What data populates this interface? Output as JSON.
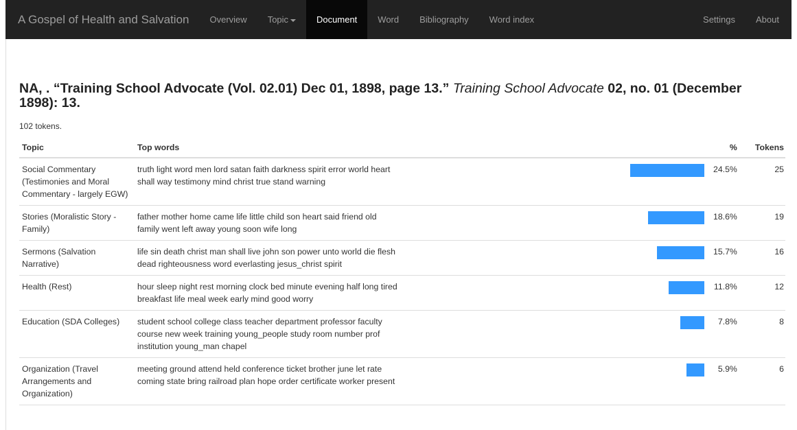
{
  "nav": {
    "brand": "A Gospel of Health and Salvation",
    "items": [
      "Overview",
      "Topic",
      "Document",
      "Word",
      "Bibliography",
      "Word index"
    ],
    "active": "Document",
    "right_items": [
      "Settings",
      "About"
    ]
  },
  "document": {
    "citation_prefix": "NA, . “Training School Advocate (Vol. 02.01) Dec 01, 1898, page 13.”",
    "citation_journal": "Training School Advocate",
    "citation_suffix": "02, no. 01 (December 1898): 13.",
    "tokens_text": "102 tokens."
  },
  "table": {
    "headers": {
      "topic": "Topic",
      "words": "Top words",
      "pct": "%",
      "tokens": "Tokens"
    },
    "rows": [
      {
        "topic": "Social Commentary (Testimonies and Moral Commentary - largely EGW)",
        "words": "truth light word men lord satan faith darkness spirit error world heart shall way testimony mind christ true stand warning",
        "percent": 24.5,
        "pct_label": "24.5%",
        "tokens": "25"
      },
      {
        "topic": "Stories (Moralistic Story - Family)",
        "words": "father mother home came life little child son heart said friend old family went left away young soon wife long",
        "percent": 18.6,
        "pct_label": "18.6%",
        "tokens": "19"
      },
      {
        "topic": "Sermons (Salvation Narrative)",
        "words": "life sin death christ man shall live john son power unto world die flesh dead righteousness word everlasting jesus_christ spirit",
        "percent": 15.7,
        "pct_label": "15.7%",
        "tokens": "16"
      },
      {
        "topic": "Health (Rest)",
        "words": "hour sleep night rest morning clock bed minute evening half long tired breakfast life meal week early mind good worry",
        "percent": 11.8,
        "pct_label": "11.8%",
        "tokens": "12"
      },
      {
        "topic": "Education (SDA Colleges)",
        "words": "student school college class teacher department professor faculty course new week training young_people study room number prof institution young_man chapel",
        "percent": 7.8,
        "pct_label": "7.8%",
        "tokens": "8"
      },
      {
        "topic": "Organization (Travel Arrangements and Organization)",
        "words": "meeting ground attend held conference ticket brother june let rate coming state bring railroad plan hope order certificate worker present",
        "percent": 5.9,
        "pct_label": "5.9%",
        "tokens": "6"
      }
    ]
  },
  "colors": {
    "navbar": "#222222",
    "active_nav": "#080808",
    "bar": "#3399ff"
  }
}
